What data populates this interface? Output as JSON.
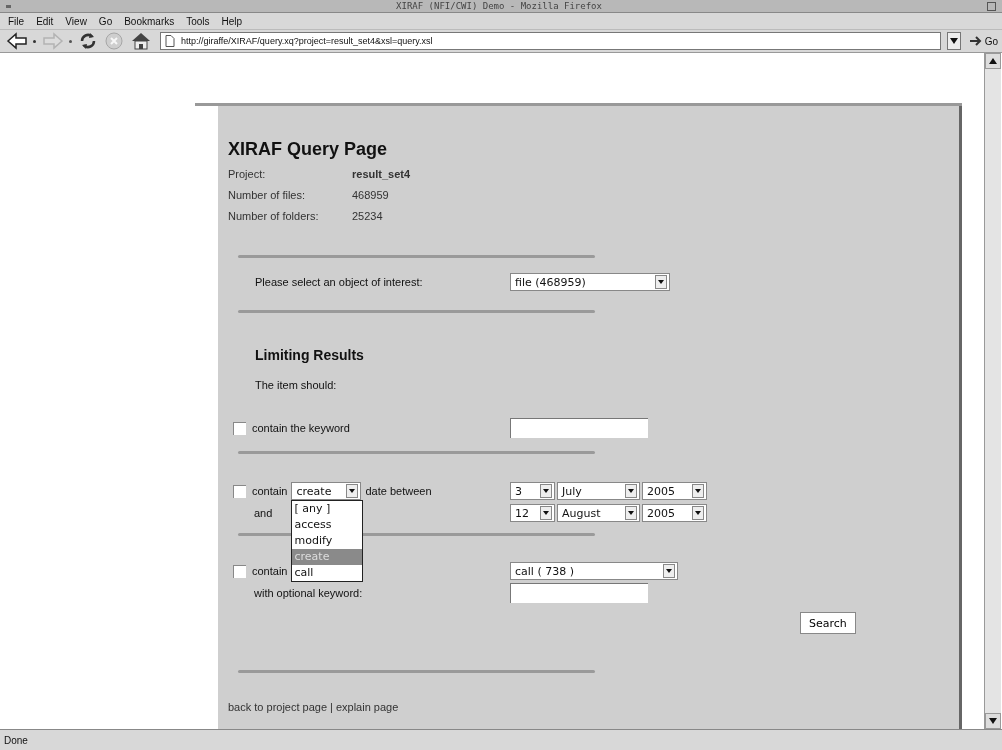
{
  "window": {
    "title": "XIRAF (NFI/CWI) Demo - Mozilla Firefox"
  },
  "menu": [
    "File",
    "Edit",
    "View",
    "Go",
    "Bookmarks",
    "Tools",
    "Help"
  ],
  "toolbar": {
    "buttons": [
      {
        "kind": "back",
        "disabled": false
      },
      {
        "kind": "forward",
        "disabled": true
      },
      {
        "kind": "reload",
        "disabled": false
      },
      {
        "kind": "stop",
        "disabled": true
      },
      {
        "kind": "home",
        "disabled": false
      }
    ],
    "url": "http://giraffe/XIRAF/query.xq?project=result_set4&xsl=query.xsl",
    "go": "Go"
  },
  "page": {
    "title": "XIRAF Query Page",
    "info": [
      {
        "label": "Project:",
        "value": "result_set4",
        "bold": true
      },
      {
        "label": "Number of files:",
        "value": "468959",
        "bold": false
      },
      {
        "label": "Number of folders:",
        "value": "25234",
        "bold": false
      }
    ],
    "object_select": {
      "label": "Please select an object of interest:",
      "value": "file (468959)"
    },
    "section": "Limiting Results",
    "intro": "The item should:",
    "criteria": [
      {
        "kind": "keyword",
        "checked": false,
        "label": "contain the keyword"
      },
      {
        "kind": "date",
        "checked": false,
        "label": "contain",
        "type_select": {
          "value": "create",
          "open": true,
          "options": [
            {
              "label": "[ any ]",
              "selected": false
            },
            {
              "label": "access",
              "selected": false
            },
            {
              "label": "modify",
              "selected": false
            },
            {
              "label": "create",
              "selected": true
            },
            {
              "label": "call",
              "selected": false
            }
          ]
        },
        "between_label": "date between",
        "and_label": "and",
        "from": {
          "day": "3",
          "month": "July",
          "year": "2005"
        },
        "to": {
          "day": "12",
          "month": "August",
          "year": "2005"
        }
      },
      {
        "kind": "type",
        "checked": false,
        "label": "contain",
        "value": "call ( 738 )",
        "keyword_label": "with optional keyword:"
      }
    ],
    "search_button": "Search",
    "footer_links": [
      "back to project page",
      "explain page"
    ],
    "footer_separator": "|"
  },
  "status_bar": "Done"
}
